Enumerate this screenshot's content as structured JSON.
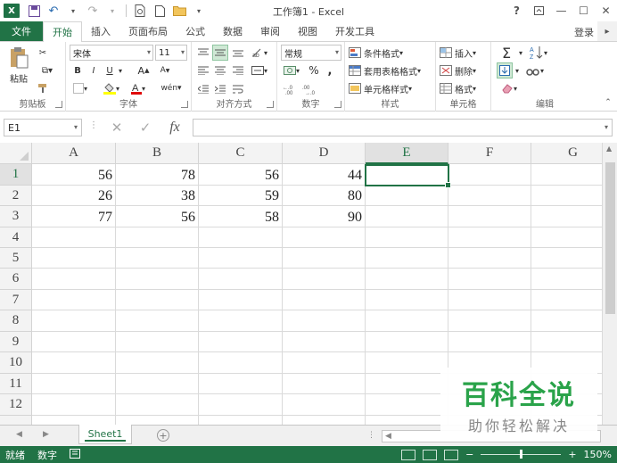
{
  "titlebar": {
    "logo": "X",
    "title": "工作簿1 - Excel",
    "help": "?",
    "restore": "🗗",
    "minimize": "—",
    "maximize": "☐",
    "close": "✕"
  },
  "tabs": {
    "file": "文件",
    "items": [
      "开始",
      "插入",
      "页面布局",
      "公式",
      "数据",
      "审阅",
      "视图",
      "开发工具"
    ],
    "login": "登录"
  },
  "ribbon": {
    "clipboard": {
      "paste": "粘贴",
      "label": "剪贴板"
    },
    "font": {
      "name": "宋体",
      "size": "11",
      "bold": "B",
      "italic": "I",
      "underline": "U",
      "label": "字体"
    },
    "alignment": {
      "label": "对齐方式"
    },
    "number": {
      "format": "常规",
      "percent": "%",
      "comma": ",",
      "label": "数字"
    },
    "styles": {
      "conditional": "条件格式",
      "table": "套用表格格式",
      "cell": "单元格样式",
      "label": "样式"
    },
    "cells": {
      "insert": "插入",
      "delete": "删除",
      "format": "格式",
      "label": "单元格"
    },
    "editing": {
      "sum": "Σ",
      "label": "编辑"
    }
  },
  "formula_bar": {
    "name_box": "E1",
    "cancel": "✕",
    "enter": "✓",
    "fx": "fx",
    "content": ""
  },
  "grid": {
    "columns": [
      "A",
      "B",
      "C",
      "D",
      "E",
      "F",
      "G"
    ],
    "rows": [
      "1",
      "2",
      "3",
      "4",
      "5",
      "6",
      "7",
      "8",
      "9",
      "10",
      "11",
      "12"
    ],
    "cells": [
      [
        "56",
        "78",
        "56",
        "44"
      ],
      [
        "26",
        "38",
        "59",
        "80"
      ],
      [
        "77",
        "56",
        "58",
        "90"
      ]
    ],
    "selected_col": "E",
    "selected_row": "1"
  },
  "sheets": {
    "tabs": [
      "Sheet1"
    ],
    "add": "+"
  },
  "status": {
    "ready": "就绪",
    "numlock": "数字",
    "zoom": "150%"
  },
  "watermark": {
    "title": "百科全说",
    "subtitle": "助你轻松解决"
  },
  "colors": {
    "accent": "#217346",
    "watermark": "#2aa34a"
  }
}
